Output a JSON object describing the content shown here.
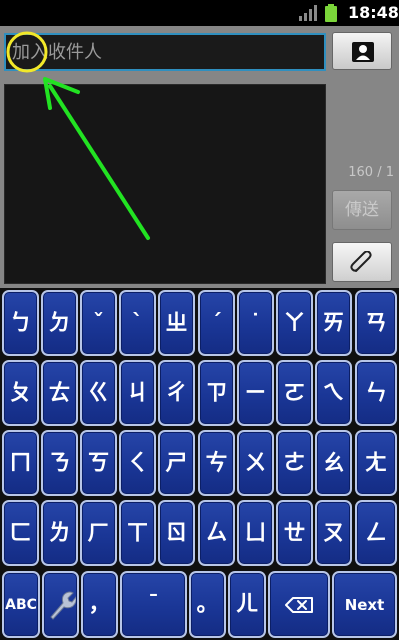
{
  "status_bar": {
    "time": "18:48"
  },
  "compose": {
    "recipient_placeholder": "加入收件人",
    "char_counter": "160 / 1",
    "send_label": "傳送"
  },
  "keyboard": {
    "rows": [
      [
        "ㄅ",
        "ㄉ",
        "ˇ",
        "ˋ",
        "ㄓ",
        "ˊ",
        "˙",
        "ㄚ",
        "ㄞ",
        "ㄢ"
      ],
      [
        "ㄆ",
        "ㄊ",
        "ㄍ",
        "ㄐ",
        "ㄔ",
        "ㄗ",
        "ㄧ",
        "ㄛ",
        "ㄟ",
        "ㄣ"
      ],
      [
        "ㄇ",
        "ㄋ",
        "ㄎ",
        "ㄑ",
        "ㄕ",
        "ㄘ",
        "ㄨ",
        "ㄜ",
        "ㄠ",
        "ㄤ"
      ],
      [
        "ㄈ",
        "ㄌ",
        "ㄏ",
        "ㄒ",
        "ㄖ",
        "ㄙ",
        "ㄩ",
        "ㄝ",
        "ㄡ",
        "ㄥ"
      ]
    ],
    "bottom": {
      "abc": "ABC",
      "settings_icon": "wrench-icon",
      "comma": "，",
      "space": "ˉ",
      "period": "。",
      "er": "ㄦ",
      "backspace_icon": "backspace-icon",
      "next": "Next"
    }
  },
  "colors": {
    "key_fill": "#1a3696",
    "key_border": "#b8c6e8",
    "input_focus": "#2f8fbf",
    "annotation_circle": "#f2e829",
    "annotation_arrow": "#22e322"
  }
}
